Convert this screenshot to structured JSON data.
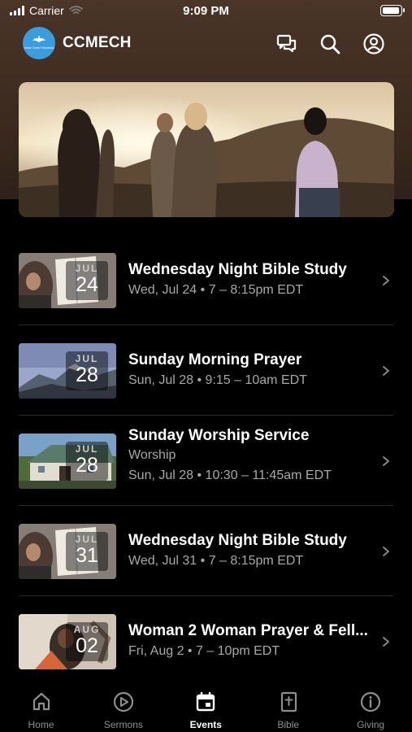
{
  "status_bar": {
    "carrier": "Carrier",
    "time": "9:09 PM",
    "battery_level": 1.0
  },
  "app_bar": {
    "logo_text": "Grace Creek Fellowship",
    "title": "CCMECH"
  },
  "events": [
    {
      "month": "JUL",
      "day": "24",
      "title": "Wednesday Night Bible Study",
      "subtitle": "",
      "when": "Wed, Jul 24 • 7 – 8:15pm EDT",
      "thumb": "bible"
    },
    {
      "month": "JUL",
      "day": "28",
      "title": "Sunday Morning Prayer",
      "subtitle": "",
      "when": "Sun, Jul 28 • 9:15 – 10am EDT",
      "thumb": "mountain"
    },
    {
      "month": "JUL",
      "day": "28",
      "title": "Sunday Worship Service",
      "subtitle": "Worship",
      "when": "Sun, Jul 28 • 10:30 – 11:45am EDT",
      "thumb": "church"
    },
    {
      "month": "JUL",
      "day": "31",
      "title": "Wednesday Night Bible Study",
      "subtitle": "",
      "when": "Wed, Jul 31 • 7 – 8:15pm EDT",
      "thumb": "bible"
    },
    {
      "month": "AUG",
      "day": "02",
      "title": "Woman 2 Woman Prayer & Fell...",
      "subtitle": "",
      "when": "Fri, Aug 2 • 7 – 10pm EDT",
      "thumb": "women"
    }
  ],
  "tabs": [
    {
      "label": "Home",
      "icon": "home-icon",
      "active": false
    },
    {
      "label": "Sermons",
      "icon": "play-icon",
      "active": false
    },
    {
      "label": "Events",
      "icon": "calendar-icon",
      "active": true
    },
    {
      "label": "Bible",
      "icon": "bible-icon",
      "active": false
    },
    {
      "label": "Giving",
      "icon": "info-icon",
      "active": false
    }
  ]
}
